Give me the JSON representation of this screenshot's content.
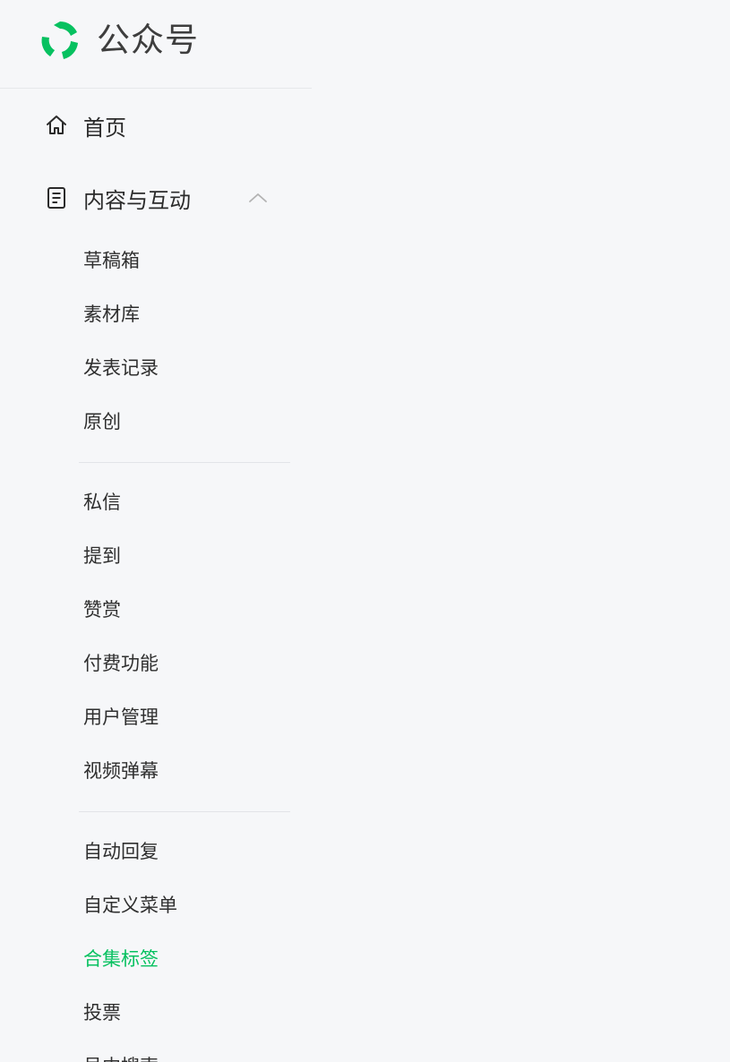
{
  "app": {
    "name": "公众号",
    "brand_color": "#07c160"
  },
  "nav": {
    "home": {
      "label": "首页",
      "icon": "home-icon"
    },
    "content": {
      "label": "内容与互动",
      "icon": "document-icon",
      "expanded": true,
      "groups": [
        [
          "草稿箱",
          "素材库",
          "发表记录",
          "原创"
        ],
        [
          "私信",
          "提到",
          "赞赏",
          "付费功能",
          "用户管理",
          "视频弹幕"
        ],
        [
          "自动回复",
          "自定义菜单",
          "合集标签",
          "投票",
          "号内搜索"
        ]
      ],
      "active_item": "合集标签"
    }
  }
}
